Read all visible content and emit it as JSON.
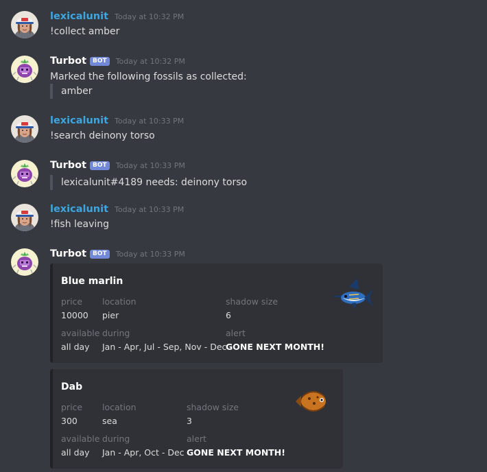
{
  "messages": [
    {
      "author": "lexicalunit",
      "timestamp": "Today at 10:32 PM",
      "text": "!collect amber"
    },
    {
      "author": "Turbot",
      "badge": "BOT",
      "timestamp": "Today at 10:32 PM",
      "text": "Marked the following fossils as collected:",
      "quote": "amber"
    },
    {
      "author": "lexicalunit",
      "timestamp": "Today at 10:33 PM",
      "text": "!search deinony torso"
    },
    {
      "author": "Turbot",
      "badge": "BOT",
      "timestamp": "Today at 10:33 PM",
      "quote": "lexicalunit#4189 needs: deinony torso"
    },
    {
      "author": "lexicalunit",
      "timestamp": "Today at 10:33 PM",
      "text": "!fish leaving"
    },
    {
      "author": "Turbot",
      "badge": "BOT",
      "timestamp": "Today at 10:33 PM"
    }
  ],
  "embeds": [
    {
      "title": "Blue marlin",
      "thumbnail_icon": "blue-marlin-fish-icon",
      "labels": {
        "price": "price",
        "location": "location",
        "shadow": "shadow size",
        "available": "available",
        "during": "during",
        "alert": "alert"
      },
      "values": {
        "price": "10000",
        "location": "pier",
        "shadow": "6",
        "available": "all day",
        "during": "Jan - Apr, Jul - Sep, Nov - Dec",
        "alert": "GONE NEXT MONTH!"
      }
    },
    {
      "title": "Dab",
      "thumbnail_icon": "dab-fish-icon",
      "labels": {
        "price": "price",
        "location": "location",
        "shadow": "shadow size",
        "available": "available",
        "during": "during",
        "alert": "alert"
      },
      "values": {
        "price": "300",
        "location": "sea",
        "shadow": "3",
        "available": "all day",
        "during": "Jan - Apr, Oct - Dec",
        "alert": "GONE NEXT MONTH!"
      }
    }
  ],
  "colors": {
    "background": "#36393f",
    "username_user": "#3da6e0",
    "bot_badge": "#7289da",
    "embed_bg": "#2f3136"
  }
}
